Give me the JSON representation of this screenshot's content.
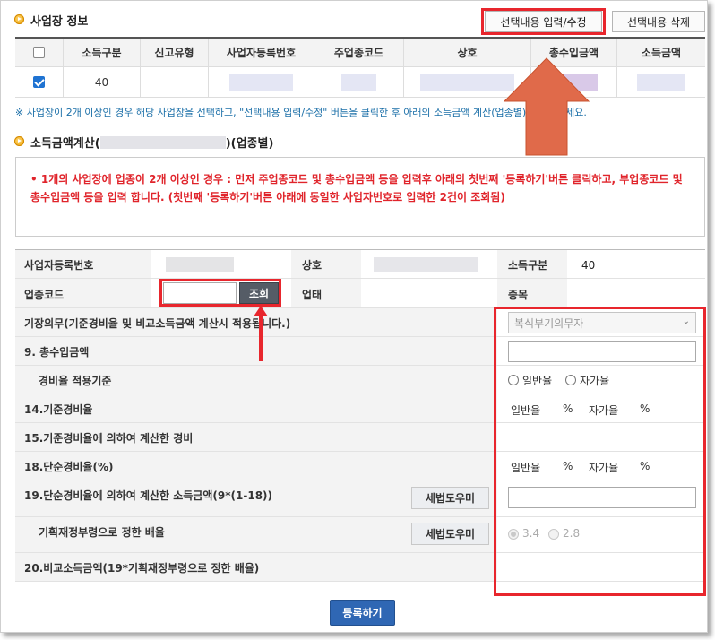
{
  "section1": {
    "title": "사업장 정보",
    "btn_edit": "선택내용 입력/수정",
    "btn_delete": "선택내용 삭제"
  },
  "table": {
    "headers": [
      "",
      "소득구분",
      "신고유형",
      "사업자등록번호",
      "주업종코드",
      "상호",
      "총수입금액",
      "소득금액"
    ],
    "row": {
      "checked": true,
      "income_type": "40"
    }
  },
  "note": "※ 사업장이 2개 이상인 경우 해당 사업장을 선택하고, \"선택내용 입력/수정\" 버튼을 클릭한 후 아래의 소득금액 계산(업종별)로 입력하세요.",
  "section2": {
    "title_prefix": "소득금액계산(",
    "title_suffix": ")(업종별)"
  },
  "warning": "• 1개의 사업장에 업종이 2개 이상인 경우 : 먼저 주업종코드 및 총수입금액 등을 입력후 아래의 첫번째 '등록하기'버튼 클릭하고, 부업종코드 및 총수입금액 등을 입력 합니다. (첫번째 '등록하기'버튼 아래에 동일한 사업자번호로 입력한 2건이 조회됨)",
  "form": {
    "biz_reg_no_label": "사업자등록번호",
    "company_label": "상호",
    "income_type_label": "소득구분",
    "income_type_value": "40",
    "industry_code_label": "업종코드",
    "lookup_btn": "조회",
    "business_type_label": "업태",
    "item_label": "종목",
    "bookkeeping_label": "기장의무(기준경비율 및 비교소득금액 계산시 적용됩니다.)",
    "bookkeeping_value": "복식부기의무자",
    "total_revenue_label": "9. 총수입금액",
    "expense_basis_label": "경비율 적용기준",
    "radio_general": "일반율",
    "radio_self": "자가율",
    "std_rate_label": "14.기준경비율",
    "rate_general": "일반율",
    "rate_self": "자가율",
    "percent": "%",
    "std_expense_label": "15.기준경비율에 의하여 계산한 경비",
    "simple_rate_label": "18.단순경비율(%)",
    "simple_income_label": "19.단순경비율에 의하여 계산한 소득금액(9*(1-18))",
    "tax_help_btn": "세법도우미",
    "multiplier_label": "기획재정부령으로 정한 배율",
    "multiplier_a": "3.4",
    "multiplier_b": "2.8",
    "compare_income_label": "20.비교소득금액(19*기획재정부령으로 정한 배율)"
  },
  "submit_btn": "등록하기",
  "colors": {
    "accent_red": "#e8262d",
    "arrow_orange": "#e06a4a",
    "submit_blue": "#2f67b4",
    "note_blue": "#1b6fa8"
  }
}
